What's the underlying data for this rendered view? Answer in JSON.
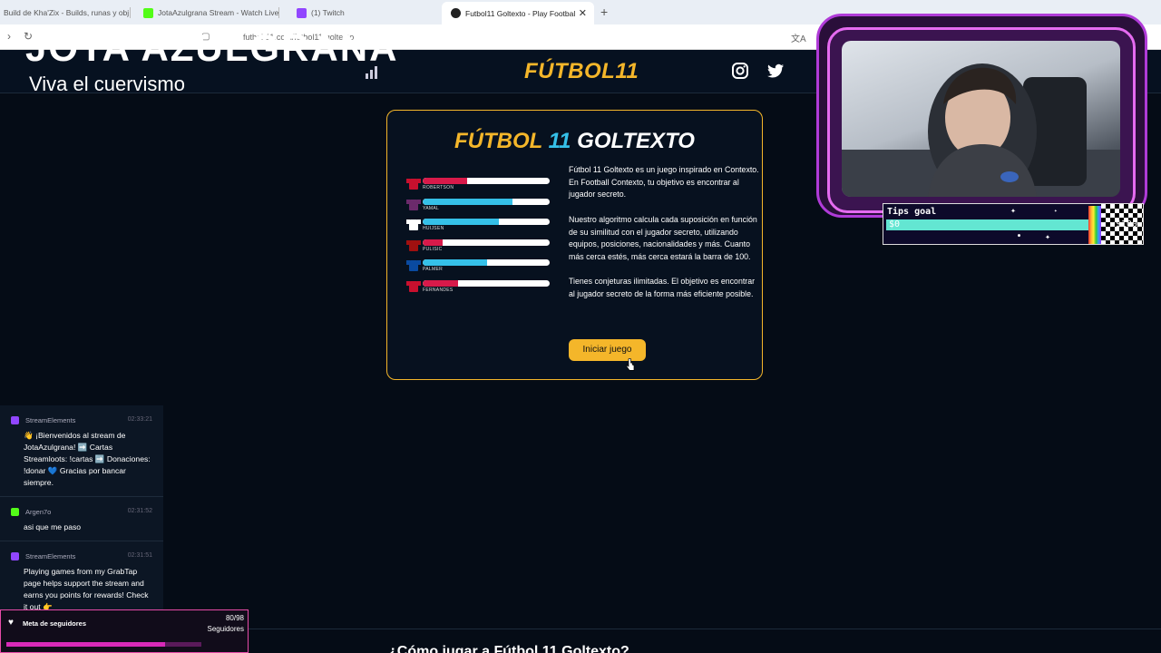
{
  "browser": {
    "tabs": [
      {
        "label": "Build de Kha'Zix - Builds, runas y obj",
        "color": "#8a8a8a"
      },
      {
        "label": "JotaAzulgrana Stream - Watch Live o",
        "color": "#53fc18"
      },
      {
        "label": "(1) Twitch",
        "color": "#9146ff"
      },
      {
        "label": "Futbol11 Goltexto - Play Footbal",
        "color": "#333333"
      }
    ],
    "url": "futbol-11.com/futbol11-goltexto"
  },
  "overlay": {
    "title": "JOTA AZULGRANA",
    "subtitle": "Viva el cuervismo"
  },
  "site": {
    "logo": "FÚTBOL11",
    "social_icons": [
      "instagram-icon",
      "twitter-icon"
    ]
  },
  "card": {
    "title_part1": "FÚTBOL",
    "title_part2": "11",
    "title_part3": "GOLTEXTO",
    "players": [
      {
        "name": "ROBERTSON",
        "fill": 0.35,
        "color": "#d81a4a",
        "shirt": "#c8102e",
        "value": ""
      },
      {
        "name": "YAMAL",
        "fill": 0.71,
        "color": "#35c0e8",
        "shirt": "#6b2a6b",
        "value": "63"
      },
      {
        "name": "HUIJSEN",
        "fill": 0.6,
        "color": "#35c0e8",
        "shirt": "#ffffff",
        "value": "36"
      },
      {
        "name": "PULISIC",
        "fill": 0.16,
        "color": "#d81a4a",
        "shirt": "#a01010",
        "value": ""
      },
      {
        "name": "PALMER",
        "fill": 0.51,
        "color": "#35c0e8",
        "shirt": "#0a4aa0",
        "value": "21"
      },
      {
        "name": "FERNANDES",
        "fill": 0.28,
        "color": "#d81a4a",
        "shirt": "#c8102e",
        "value": ""
      }
    ],
    "paragraphs": [
      "Fútbol 11 Goltexto es un juego inspirado en Contexto. En Football Contexto, tu objetivo es encontrar al jugador secreto.",
      "Nuestro algoritmo calcula cada suposición en función de su similitud con el jugador secreto, utilizando equipos, posiciones, nacionalidades y más. Cuanto más cerca estés, más cerca estará la barra de 100.",
      "Tienes conjeturas ilimitadas. El objetivo es encontrar al jugador secreto de la forma más eficiente posible."
    ],
    "start_button": "Iniciar juego"
  },
  "tips_goal": {
    "title": "Tips goal",
    "current": "$0",
    "target": "$100",
    "progress": 0
  },
  "chat": {
    "messages": [
      {
        "user": "StreamElements",
        "time": "02:33:21",
        "text": "👋 ¡Bienvenidos al stream de JotaAzulgrana! ➡️ Cartas Streamloots: !cartas ➡️ Donaciones: !donar 💙 Gracias por bancar siempre.",
        "icon_color": "#9146ff"
      },
      {
        "user": "Argen7o",
        "time": "02:31:52",
        "text": "asi que me paso",
        "icon_color": "#53fc18"
      },
      {
        "user": "StreamElements",
        "time": "02:31:51",
        "text": "Playing games from my GrabTap page helps support the stream and earns you points for rewards! Check it out 👉",
        "icon_color": "#9146ff"
      }
    ]
  },
  "follower_goal": {
    "label": "Meta de seguidores",
    "count": "80/98",
    "sub": "Seguidores",
    "progress": 0.816
  },
  "bottom_heading": "¿Cómo jugar a Fútbol 11 Goltexto?",
  "colors": {
    "accent": "#f4b62a",
    "cyan": "#35c0e8",
    "background": "#050c16"
  }
}
